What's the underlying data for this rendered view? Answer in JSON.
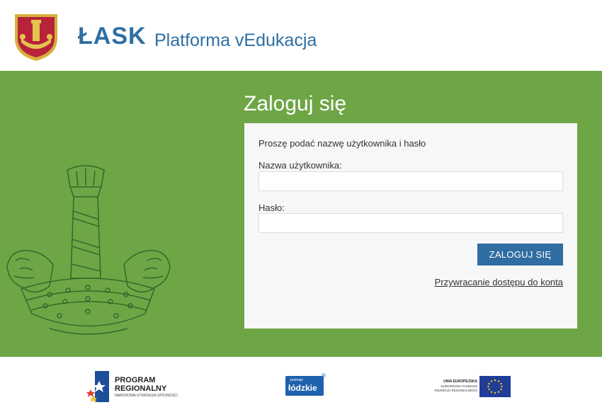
{
  "header": {
    "brand": "ŁASK",
    "subtitle": "Platforma vEdukacja"
  },
  "login": {
    "title": "Zaloguj się",
    "prompt": "Proszę podać nazwę użytkownika i hasło",
    "username_label": "Nazwa użytkownika:",
    "username_value": "",
    "password_label": "Hasło:",
    "password_value": "",
    "submit_label": "ZALOGUJ SIĘ",
    "recover_link": "Przywracanie dostępu do konta"
  },
  "footer": {
    "program": {
      "line1": "PROGRAM",
      "line2": "REGIONALNY",
      "line3": "NARODOWA STRATEGIA SPÓJNOŚCI"
    },
    "lodzkie": {
      "small": "promuje",
      "big": "łódzkie",
      "mark": "®"
    },
    "eu": {
      "line1": "UNIA EUROPEJSKA",
      "line2": "EUROPEJSKI FUNDUSZ",
      "line3": "ROZWOJU REGIONALNEGO"
    }
  },
  "colors": {
    "brand_blue": "#2e6fa3",
    "green_band": "#6ea646",
    "button": "#2f6da2",
    "panel_bg": "#f7f7f7"
  },
  "icons": {
    "crest": "lask-coat-of-arms",
    "emblem": "lask-horn-and-lions-outline",
    "eu_flag": "eu-flag"
  }
}
